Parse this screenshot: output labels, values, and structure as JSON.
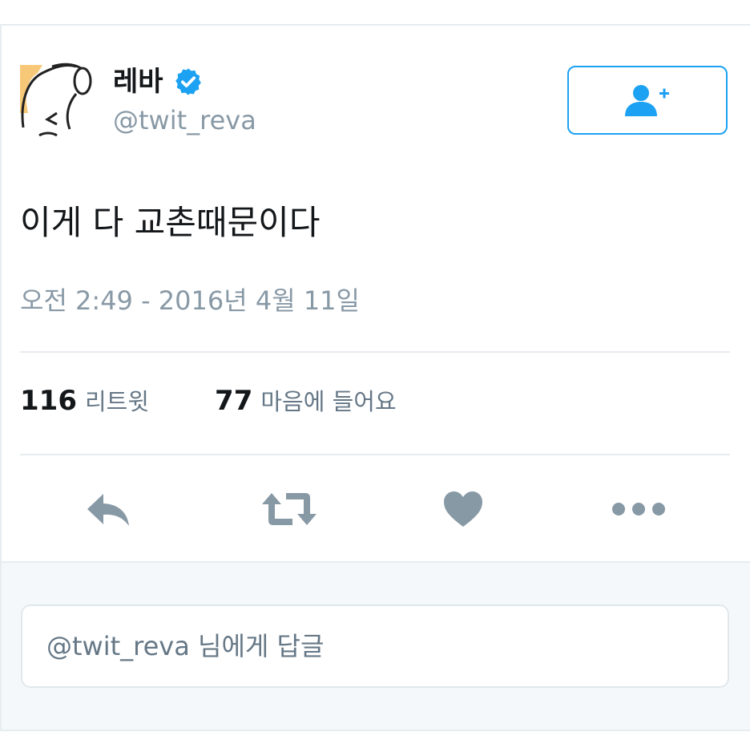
{
  "tweet": {
    "display_name": "레바",
    "handle": "@twit_reva",
    "text": "이게 다 교촌때문이다",
    "timestamp": "오전 2:49 - 2016년 4월 11일",
    "verified": true
  },
  "stats": {
    "retweets": {
      "count": "116",
      "label": "리트윗"
    },
    "likes": {
      "count": "77",
      "label": "마음에 들어요"
    }
  },
  "actions": [
    "reply-icon",
    "retweet-icon",
    "heart-icon",
    "more-icon"
  ],
  "reply": {
    "placeholder": "@twit_reva 님에게 답글"
  },
  "colors": {
    "accent": "#1da1f2",
    "icon": "#8899a6",
    "text": "#14171a",
    "muted": "#8899a6",
    "border": "#e6ecf0"
  }
}
